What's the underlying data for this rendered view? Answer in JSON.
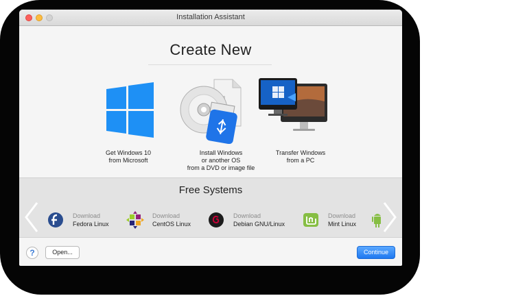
{
  "window": {
    "title": "Installation Assistant"
  },
  "create": {
    "heading": "Create New",
    "options": [
      {
        "line1": "Get Windows 10",
        "line2": "from Microsoft",
        "line3": ""
      },
      {
        "line1": "Install Windows",
        "line2": "or another OS",
        "line3": "from a DVD or image file"
      },
      {
        "line1": "Transfer Windows",
        "line2": "from a PC",
        "line3": ""
      }
    ]
  },
  "free": {
    "heading": "Free Systems",
    "items": [
      {
        "download": "Download",
        "name": "Fedora Linux",
        "icon": "fedora-icon"
      },
      {
        "download": "Download",
        "name": "CentOS Linux",
        "icon": "centos-icon"
      },
      {
        "download": "Download",
        "name": "Debian GNU/Linux",
        "icon": "debian-icon"
      },
      {
        "download": "Download",
        "name": "Mint Linux",
        "icon": "mint-icon"
      }
    ],
    "partial_icon": "android-icon"
  },
  "footer": {
    "help": "?",
    "open": "Open...",
    "continue": "Continue"
  },
  "colors": {
    "accent": "#1e78f0",
    "windows_blue": "#1e90f5",
    "fedora": "#2a4d8f",
    "debian": "#c70036",
    "mint": "#86be43"
  }
}
